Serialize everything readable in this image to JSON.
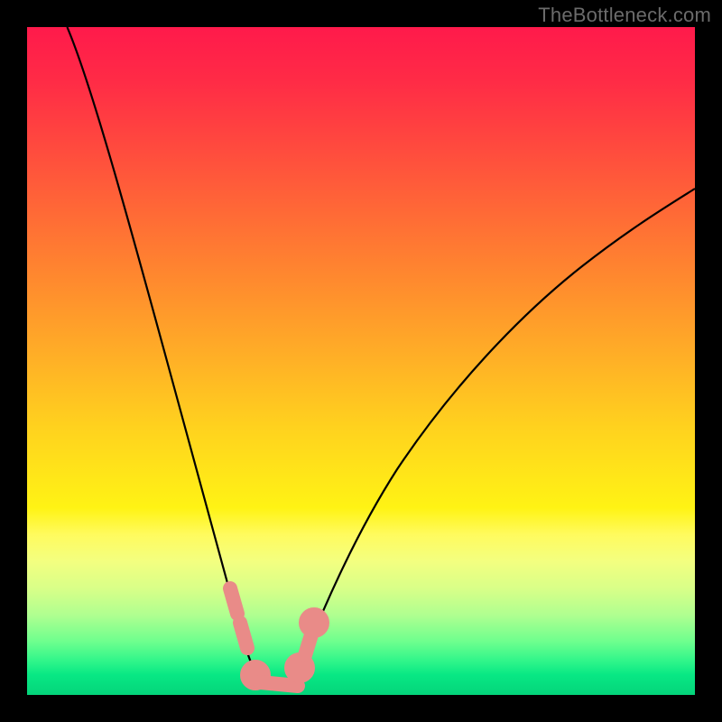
{
  "watermark": "TheBottleneck.com",
  "colors": {
    "frame": "#000000",
    "curve": "#000000",
    "marker": "#e98b88",
    "gradient_top": "#ff1a4b",
    "gradient_mid": "#ffd21e",
    "gradient_bottom": "#04d47a"
  },
  "chart_data": {
    "type": "line",
    "title": "",
    "xlabel": "",
    "ylabel": "",
    "xlim": [
      0,
      100
    ],
    "ylim": [
      0,
      100
    ],
    "curve": {
      "name": "bottleneck-curve",
      "description": "V-shaped bottleneck curve: steep drop on the left branch, shallower rise on the right branch, minimum near x≈35.",
      "points": [
        {
          "x": 6,
          "y": 100
        },
        {
          "x": 9,
          "y": 92.7
        },
        {
          "x": 12,
          "y": 83.8
        },
        {
          "x": 15,
          "y": 74.3
        },
        {
          "x": 18,
          "y": 64.3
        },
        {
          "x": 21,
          "y": 53.6
        },
        {
          "x": 24,
          "y": 42.4
        },
        {
          "x": 27,
          "y": 30.5
        },
        {
          "x": 30,
          "y": 18.1
        },
        {
          "x": 32,
          "y": 9.5
        },
        {
          "x": 33.5,
          "y": 3.0
        },
        {
          "x": 35,
          "y": 0.5
        },
        {
          "x": 37,
          "y": 0.5
        },
        {
          "x": 39,
          "y": 1.5
        },
        {
          "x": 41,
          "y": 4.5
        },
        {
          "x": 43,
          "y": 8.1
        },
        {
          "x": 46,
          "y": 13.2
        },
        {
          "x": 50,
          "y": 19.5
        },
        {
          "x": 55,
          "y": 26.5
        },
        {
          "x": 60,
          "y": 32.8
        },
        {
          "x": 65,
          "y": 38.5
        },
        {
          "x": 70,
          "y": 43.8
        },
        {
          "x": 75,
          "y": 48.5
        },
        {
          "x": 80,
          "y": 52.9
        },
        {
          "x": 85,
          "y": 57.0
        },
        {
          "x": 90,
          "y": 60.8
        },
        {
          "x": 95,
          "y": 64.3
        },
        {
          "x": 100,
          "y": 67.6
        }
      ]
    },
    "markers": {
      "name": "highlight-points",
      "color": "#e98b88",
      "points": [
        {
          "x": 30.4,
          "y": 15.8
        },
        {
          "x": 31.4,
          "y": 11.6
        },
        {
          "x": 32.4,
          "y": 7.3
        },
        {
          "x": 34.1,
          "y": 2.0
        },
        {
          "x": 36.2,
          "y": 1.1
        },
        {
          "x": 38.4,
          "y": 1.4
        },
        {
          "x": 40.5,
          "y": 3.4
        },
        {
          "x": 42.3,
          "y": 6.6
        },
        {
          "x": 42.8,
          "y": 10.5
        }
      ]
    }
  }
}
